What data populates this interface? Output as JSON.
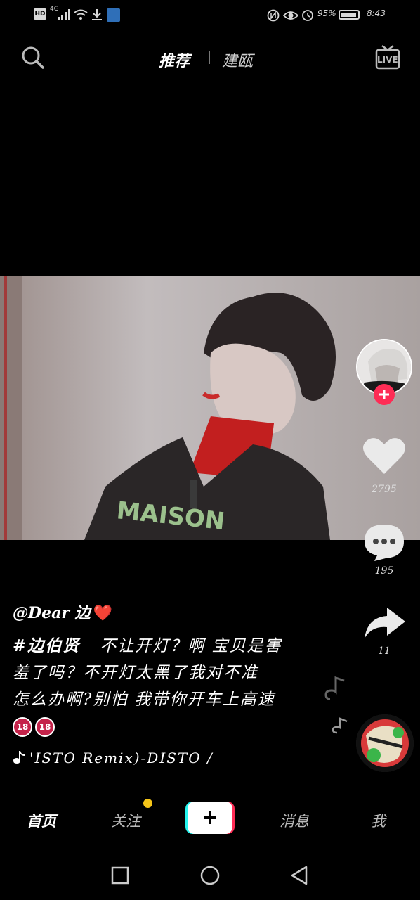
{
  "status_bar": {
    "hd": "HD",
    "network": "4G",
    "battery_text": "95%",
    "battery_level": 0.95,
    "time": "8:43"
  },
  "top_nav": {
    "search_icon": "search-icon",
    "tabs": [
      {
        "label": "推荐",
        "active": true
      },
      {
        "label": "建瓯",
        "active": false
      }
    ],
    "live_label": "LIVE"
  },
  "right_rail": {
    "follow_icon": "plus-icon",
    "likes": "2795",
    "comments": "195",
    "shares": "11"
  },
  "post": {
    "author": "@Dear 边",
    "author_emoji": "❤️",
    "hashtag": "#边伯贤",
    "caption_line1": "不让开灯？啊 宝贝是害",
    "caption_line2": "羞了吗？不开灯太黑了我对不准",
    "caption_line3": "怎么办啊?别怕 我带你开车上高速",
    "badges": [
      "18",
      "18"
    ],
    "music": "'ISTO Remix)-DISTO /"
  },
  "bottom_tabs": [
    {
      "label": "首页",
      "active": true
    },
    {
      "label": "关注",
      "active": false
    },
    {
      "label": "消息",
      "active": false
    },
    {
      "label": "我",
      "active": false
    }
  ],
  "colors": {
    "accent": "#fe2c55",
    "notification_dot": "#f5c518",
    "cyan": "#25f4ee"
  }
}
